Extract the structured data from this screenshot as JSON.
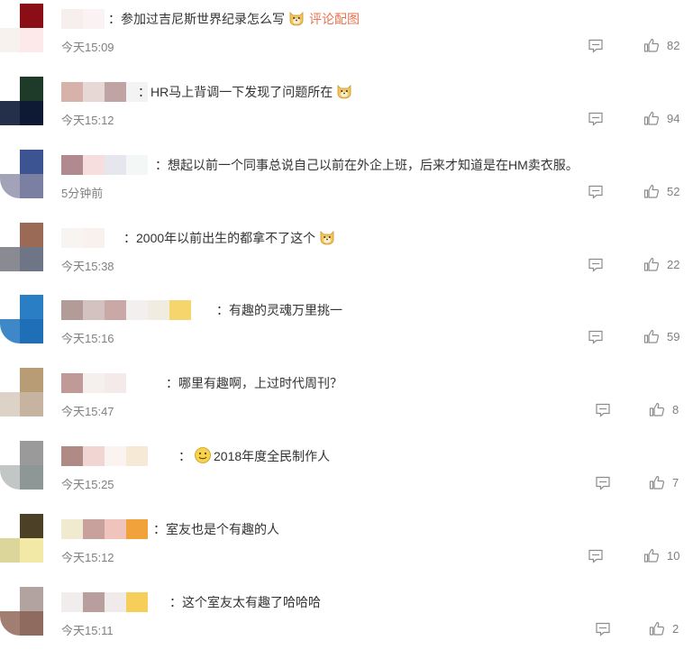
{
  "comments": [
    {
      "text": "：参加过吉尼斯世界纪录怎么写",
      "emoji": "doge",
      "link": "评论配图",
      "time": "今天15:09",
      "likes": "82"
    },
    {
      "text": "：HR马上背调一下发现了问题所在",
      "emoji": "doge",
      "time": "今天15:12",
      "likes": "94"
    },
    {
      "text": "：想起以前一个同事总说自己以前在外企上班，后来才知道是在HM卖衣服。",
      "time": "5分钟前",
      "likes": "52"
    },
    {
      "text": "：2000年以前出生的都拿不了这个",
      "emoji": "doge",
      "time": "今天15:38",
      "likes": "22"
    },
    {
      "text": "：有趣的灵魂万里挑一",
      "time": "今天15:16",
      "likes": "59"
    },
    {
      "text": "：哪里有趣啊，上过时代周刊？",
      "time": "今天15:47",
      "likes": "8"
    },
    {
      "text": "2018年度全民制作人",
      "emoji_before": "smile",
      "prefix": "：",
      "time": "今天15:25",
      "likes": "7"
    },
    {
      "text": "：室友也是个有趣的人",
      "time": "今天15:12",
      "likes": "10"
    },
    {
      "text": "：这个室友太有趣了哈哈哈",
      "time": "今天15:11",
      "likes": "2"
    }
  ],
  "icons": {
    "reply": "comment-reply-icon",
    "like": "thumbs-up-icon",
    "doge": "doge-emoji-icon",
    "smile": "smile-emoji-icon"
  },
  "colors": {
    "link": "#eb7350",
    "meta": "#808080",
    "text": "#333333"
  }
}
